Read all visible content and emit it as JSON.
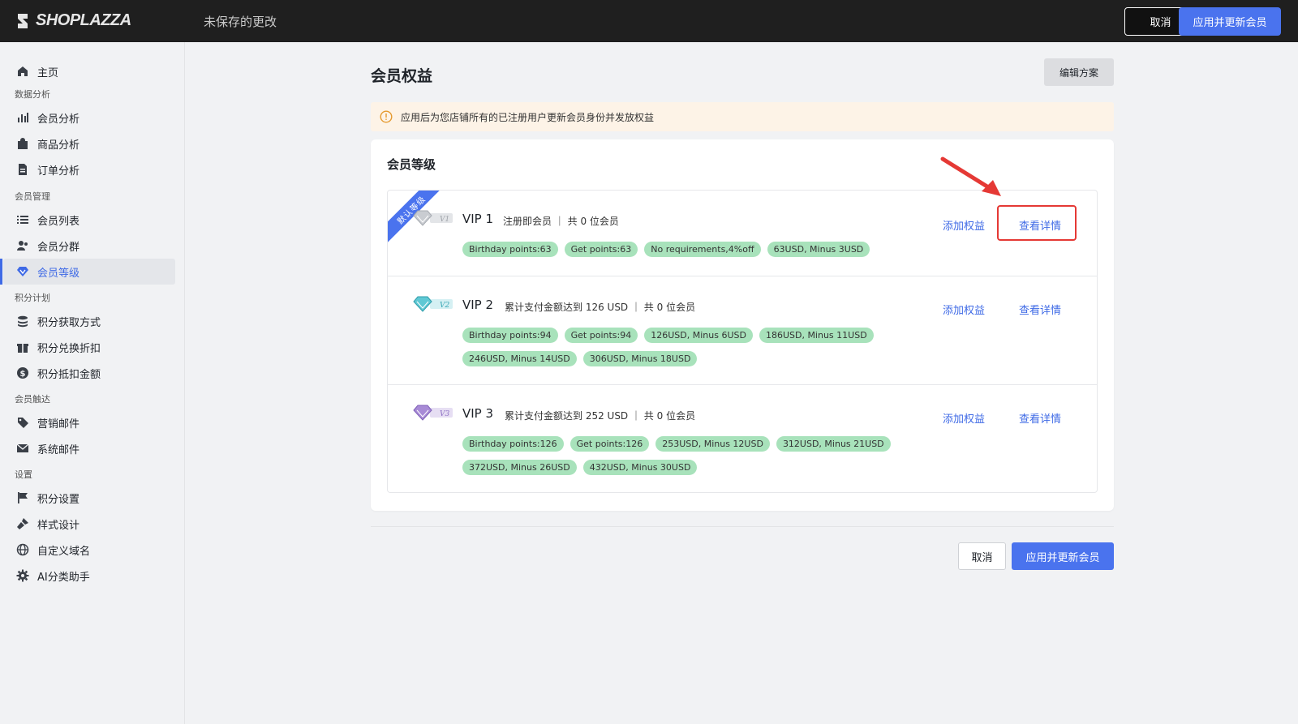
{
  "app": {
    "brand": "SHOPLAZZA",
    "status_text": "未保存的更改",
    "cancel_label": "取消",
    "apply_label": "应用并更新会员",
    "accent": "#4a73ee"
  },
  "sidebar": {
    "home": "主页",
    "sections": {
      "analytics": "数据分析",
      "member_mgmt": "会员管理",
      "points_plan": "积分计划",
      "member_reach": "会员触达",
      "settings": "设置"
    },
    "items": {
      "member_analysis": "会员分析",
      "product_analysis": "商品分析",
      "order_analysis": "订单分析",
      "member_list": "会员列表",
      "member_groups": "会员分群",
      "member_levels": "会员等级",
      "points_earn": "积分获取方式",
      "points_redeem": "积分兑换折扣",
      "points_deduct": "积分抵扣金额",
      "marketing_email": "营销邮件",
      "system_email": "系统邮件",
      "points_settings": "积分设置",
      "style_design": "样式设计",
      "custom_domain": "自定义域名",
      "ai_assistant": "AI分类助手"
    },
    "active": "会员等级"
  },
  "main": {
    "title": "会员权益",
    "edit_plan": "编辑方案",
    "banner": "应用后为您店铺所有的已注册用户更新会员身份并发放权益",
    "card_title": "会员等级",
    "default_ribbon": "默认等级",
    "add_benefit": "添加权益",
    "view_details": "查看详情",
    "levels": [
      {
        "name": "VIP 1",
        "badge": "V1",
        "desc": "注册即会员 ｜ 共 0 位会员",
        "tags": [
          "Birthday points:63",
          "Get points:63",
          "No requirements,4%off",
          "63USD, Minus 3USD"
        ]
      },
      {
        "name": "VIP 2",
        "badge": "V2",
        "desc": "累计支付金额达到 126 USD ｜ 共 0 位会员",
        "tags": [
          "Birthday points:94",
          "Get points:94",
          "126USD, Minus 6USD",
          "186USD, Minus 11USD",
          "246USD, Minus 14USD",
          "306USD, Minus 18USD"
        ]
      },
      {
        "name": "VIP 3",
        "badge": "V3",
        "desc": "累计支付金额达到 252 USD ｜ 共 0 位会员",
        "tags": [
          "Birthday points:126",
          "Get points:126",
          "253USD, Minus 12USD",
          "312USD, Minus 21USD",
          "372USD, Minus 26USD",
          "432USD, Minus 30USD"
        ]
      }
    ],
    "bottom_cancel": "取消",
    "bottom_apply": "应用并更新会员"
  }
}
